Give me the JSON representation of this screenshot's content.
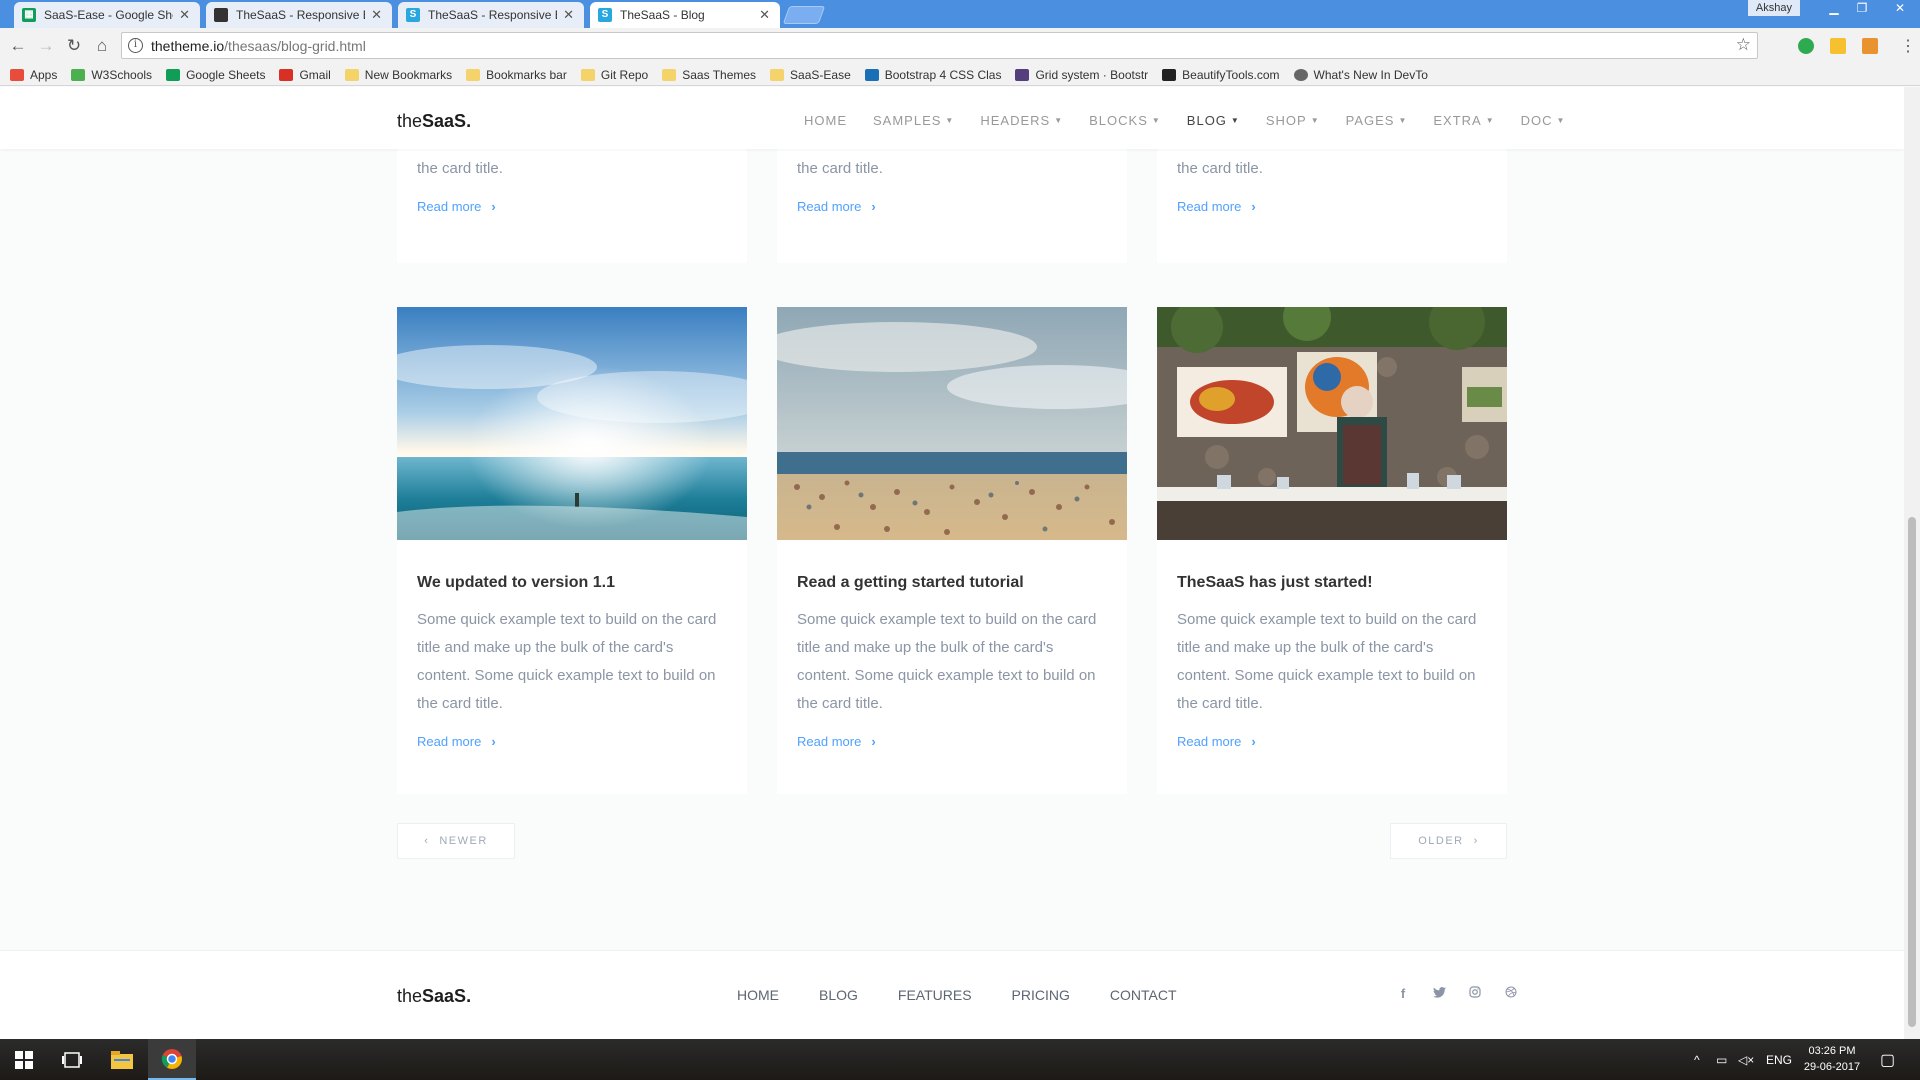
{
  "browser": {
    "tabs": [
      {
        "title": "SaaS-Ease - Google She",
        "favicon": "sheets-icon",
        "fav_color": "#0f9d58",
        "active": false
      },
      {
        "title": "TheSaaS - Responsive Bo",
        "favicon": "theme-thumb-icon",
        "fav_color": "#333333",
        "active": false
      },
      {
        "title": "TheSaaS - Responsive Bo",
        "favicon": "s-logo-icon",
        "fav_color": "#29a8e0",
        "active": false
      },
      {
        "title": "TheSaaS - Blog",
        "favicon": "s-logo-icon",
        "fav_color": "#29a8e0",
        "active": true
      }
    ],
    "close_glyph": "✕",
    "user": "Akshay",
    "url_host": "thetheme.io",
    "url_path": "/thesaas/blog-grid.html",
    "bookmarks": [
      {
        "label": "Apps",
        "icon": "apps-grid-icon",
        "color": "#e74c3c"
      },
      {
        "label": "W3Schools",
        "icon": "w3schools-icon",
        "color": "#4caf50"
      },
      {
        "label": "Google Sheets",
        "icon": "sheets-icon",
        "color": "#0f9d58"
      },
      {
        "label": "Gmail",
        "icon": "gmail-icon",
        "color": "#d93025"
      },
      {
        "label": "New Bookmarks",
        "icon": "folder-icon",
        "color": "#f4d36b"
      },
      {
        "label": "Bookmarks bar",
        "icon": "folder-icon",
        "color": "#f4d36b"
      },
      {
        "label": "Git Repo",
        "icon": "folder-icon",
        "color": "#f4d36b"
      },
      {
        "label": "Saas Themes",
        "icon": "folder-icon",
        "color": "#f4d36b"
      },
      {
        "label": "SaaS-Ease",
        "icon": "folder-icon",
        "color": "#f4d36b"
      },
      {
        "label": "Bootstrap 4 CSS Clas",
        "icon": "bootstrap-icon",
        "color": "#1b6fb5"
      },
      {
        "label": "Grid system · Bootstr",
        "icon": "bootstrap-b-icon",
        "color": "#563d7c"
      },
      {
        "label": "BeautifyTools.com",
        "icon": "beautify-icon",
        "color": "#222222"
      },
      {
        "label": "What's New In DevTo",
        "icon": "devtools-icon",
        "color": "#666666"
      }
    ]
  },
  "site": {
    "logo_prefix": "the",
    "logo_main": "SaaS.",
    "nav": [
      {
        "label": "HOME",
        "dropdown": false,
        "active": false
      },
      {
        "label": "SAMPLES",
        "dropdown": true,
        "active": false
      },
      {
        "label": "HEADERS",
        "dropdown": true,
        "active": false
      },
      {
        "label": "BLOCKS",
        "dropdown": true,
        "active": false
      },
      {
        "label": "BLOG",
        "dropdown": true,
        "active": true
      },
      {
        "label": "SHOP",
        "dropdown": true,
        "active": false
      },
      {
        "label": "PAGES",
        "dropdown": true,
        "active": false
      },
      {
        "label": "EXTRA",
        "dropdown": true,
        "active": false
      },
      {
        "label": "DOC",
        "dropdown": true,
        "active": false
      }
    ],
    "accent": "#50a1ff"
  },
  "top_cards": [
    {
      "text": "content. Some quick example text to build on the card title.",
      "more": "Read more"
    },
    {
      "text": "content. Some quick example text to build on the card title.",
      "more": "Read more"
    },
    {
      "text": "content. Some quick example text to build on the card title.",
      "more": "Read more"
    }
  ],
  "cards": [
    {
      "title": "We updated to version 1.1",
      "image": "ocean-sunrise-photo",
      "text": "Some quick example text to build on the card title and make up the bulk of the card's content. Some quick example text to build on the card title.",
      "more": "Read more"
    },
    {
      "title": "Read a getting started tutorial",
      "image": "crowded-beach-photo",
      "text": "Some quick example text to build on the card title and make up the bulk of the card's content. Some quick example text to build on the card title.",
      "more": "Read more"
    },
    {
      "title": "TheSaaS has just started!",
      "image": "painter-at-work-photo",
      "text": "Some quick example text to build on the card title and make up the bulk of the card's content. Some quick example text to build on the card title.",
      "more": "Read more"
    }
  ],
  "pager": {
    "newer": "NEWER",
    "older": "OLDER"
  },
  "footer": {
    "nav": [
      "HOME",
      "BLOG",
      "FEATURES",
      "PRICING",
      "CONTACT"
    ],
    "socials": [
      "facebook-icon",
      "twitter-icon",
      "instagram-icon",
      "dribbble-icon"
    ]
  },
  "taskbar": {
    "language": "ENG",
    "time": "03:26 PM",
    "date": "29-06-2017"
  }
}
